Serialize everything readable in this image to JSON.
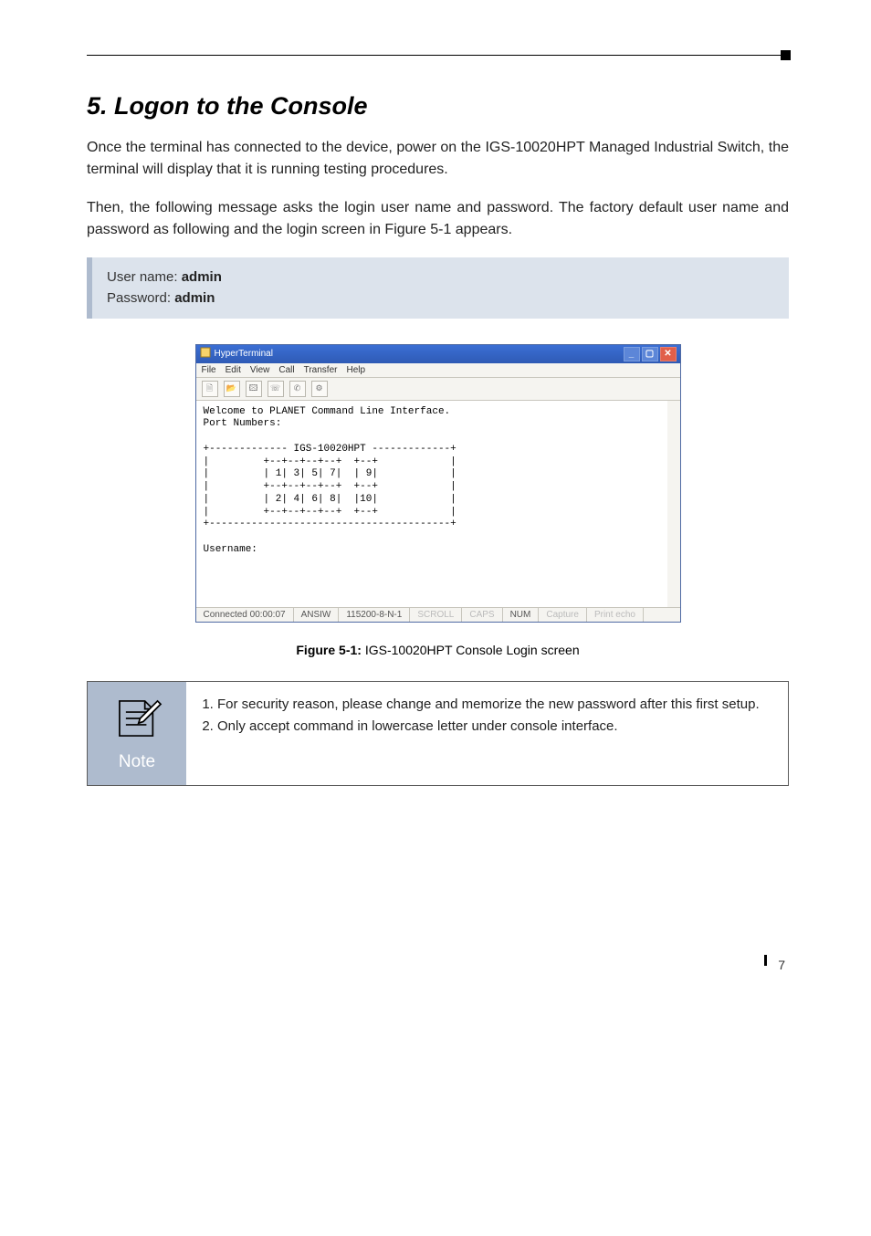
{
  "heading": "5. Logon to the Console",
  "para1": "Once the terminal has connected to the device, power on the IGS-10020HPT Managed Industrial Switch, the terminal will display that it is running testing procedures.",
  "para2": "Then, the following message asks the login user name and password. The factory default user name and password as following and the login screen in Figure 5-1 appears.",
  "cred": {
    "user_label": "User name: ",
    "user_value": "admin",
    "pass_label": "Password: ",
    "pass_value": "admin"
  },
  "ht": {
    "title": "HyperTerminal",
    "menu": [
      "File",
      "Edit",
      "View",
      "Call",
      "Transfer",
      "Help"
    ],
    "icons": [
      "new-doc-icon",
      "open-icon",
      "paste-icon",
      "call-icon",
      "hangup-icon",
      "props-icon"
    ],
    "term": "Welcome to PLANET Command Line Interface.\nPort Numbers:\n\n+------------- IGS-10020HPT -------------+\n|         +--+--+--+--+  +--+            |\n|         | 1| 3| 5| 7|  | 9|            |\n|         +--+--+--+--+  +--+            |\n|         | 2| 4| 6| 8|  |10|            |\n|         +--+--+--+--+  +--+            |\n+----------------------------------------+\n\nUsername:",
    "status": {
      "conn": "Connected 00:00:07",
      "term": "ANSIW",
      "rate": "115200-8-N-1",
      "scroll": "SCROLL",
      "caps": "CAPS",
      "num": "NUM",
      "capture": "Capture",
      "echo": "Print echo"
    }
  },
  "caption_bold": "Figure 5-1:",
  "caption_rest": "  IGS-10020HPT Console Login screen",
  "note": {
    "label": "Note",
    "items": [
      "For security reason, please change and memorize the new password after this first setup.",
      "Only accept command in lowercase letter under console interface."
    ]
  },
  "page_number": "7"
}
